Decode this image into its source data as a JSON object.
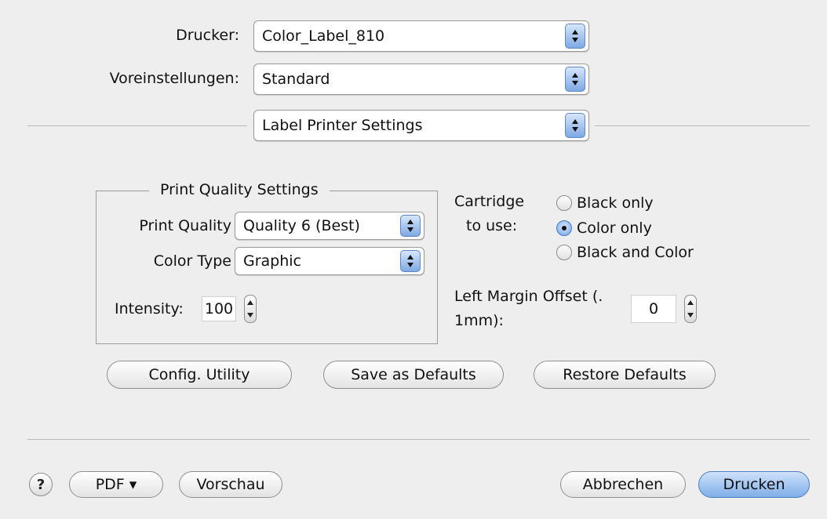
{
  "printer": {
    "label": "Drucker:",
    "value": "Color_Label_810"
  },
  "presets": {
    "label": "Voreinstellungen:",
    "value": "Standard"
  },
  "panel_select": {
    "value": "Label Printer Settings"
  },
  "print_quality_group": {
    "title": "Print Quality Settings",
    "quality_label": "Print Quality",
    "quality_value": "Quality 6 (Best)",
    "color_type_label": "Color Type",
    "color_type_value": "Graphic",
    "intensity_label": "Intensity:",
    "intensity_value": "100"
  },
  "cartridge": {
    "label_line1": "Cartridge",
    "label_line2": "to use:",
    "options": [
      {
        "label": "Black only",
        "selected": false
      },
      {
        "label": "Color only",
        "selected": true
      },
      {
        "label": "Black and Color",
        "selected": false
      }
    ]
  },
  "left_margin": {
    "label_line1": "Left Margin Offset (.",
    "label_line2": "1mm):",
    "value": "0"
  },
  "buttons": {
    "config_utility": "Config. Utility",
    "save_defaults": "Save as Defaults",
    "restore_defaults": "Restore Defaults"
  },
  "footer": {
    "help": "?",
    "pdf": "PDF ▾",
    "preview": "Vorschau",
    "cancel": "Abbrechen",
    "print": "Drucken"
  },
  "colors": {
    "accent_blue": "#7eaee8",
    "background": "#eeeeee"
  }
}
